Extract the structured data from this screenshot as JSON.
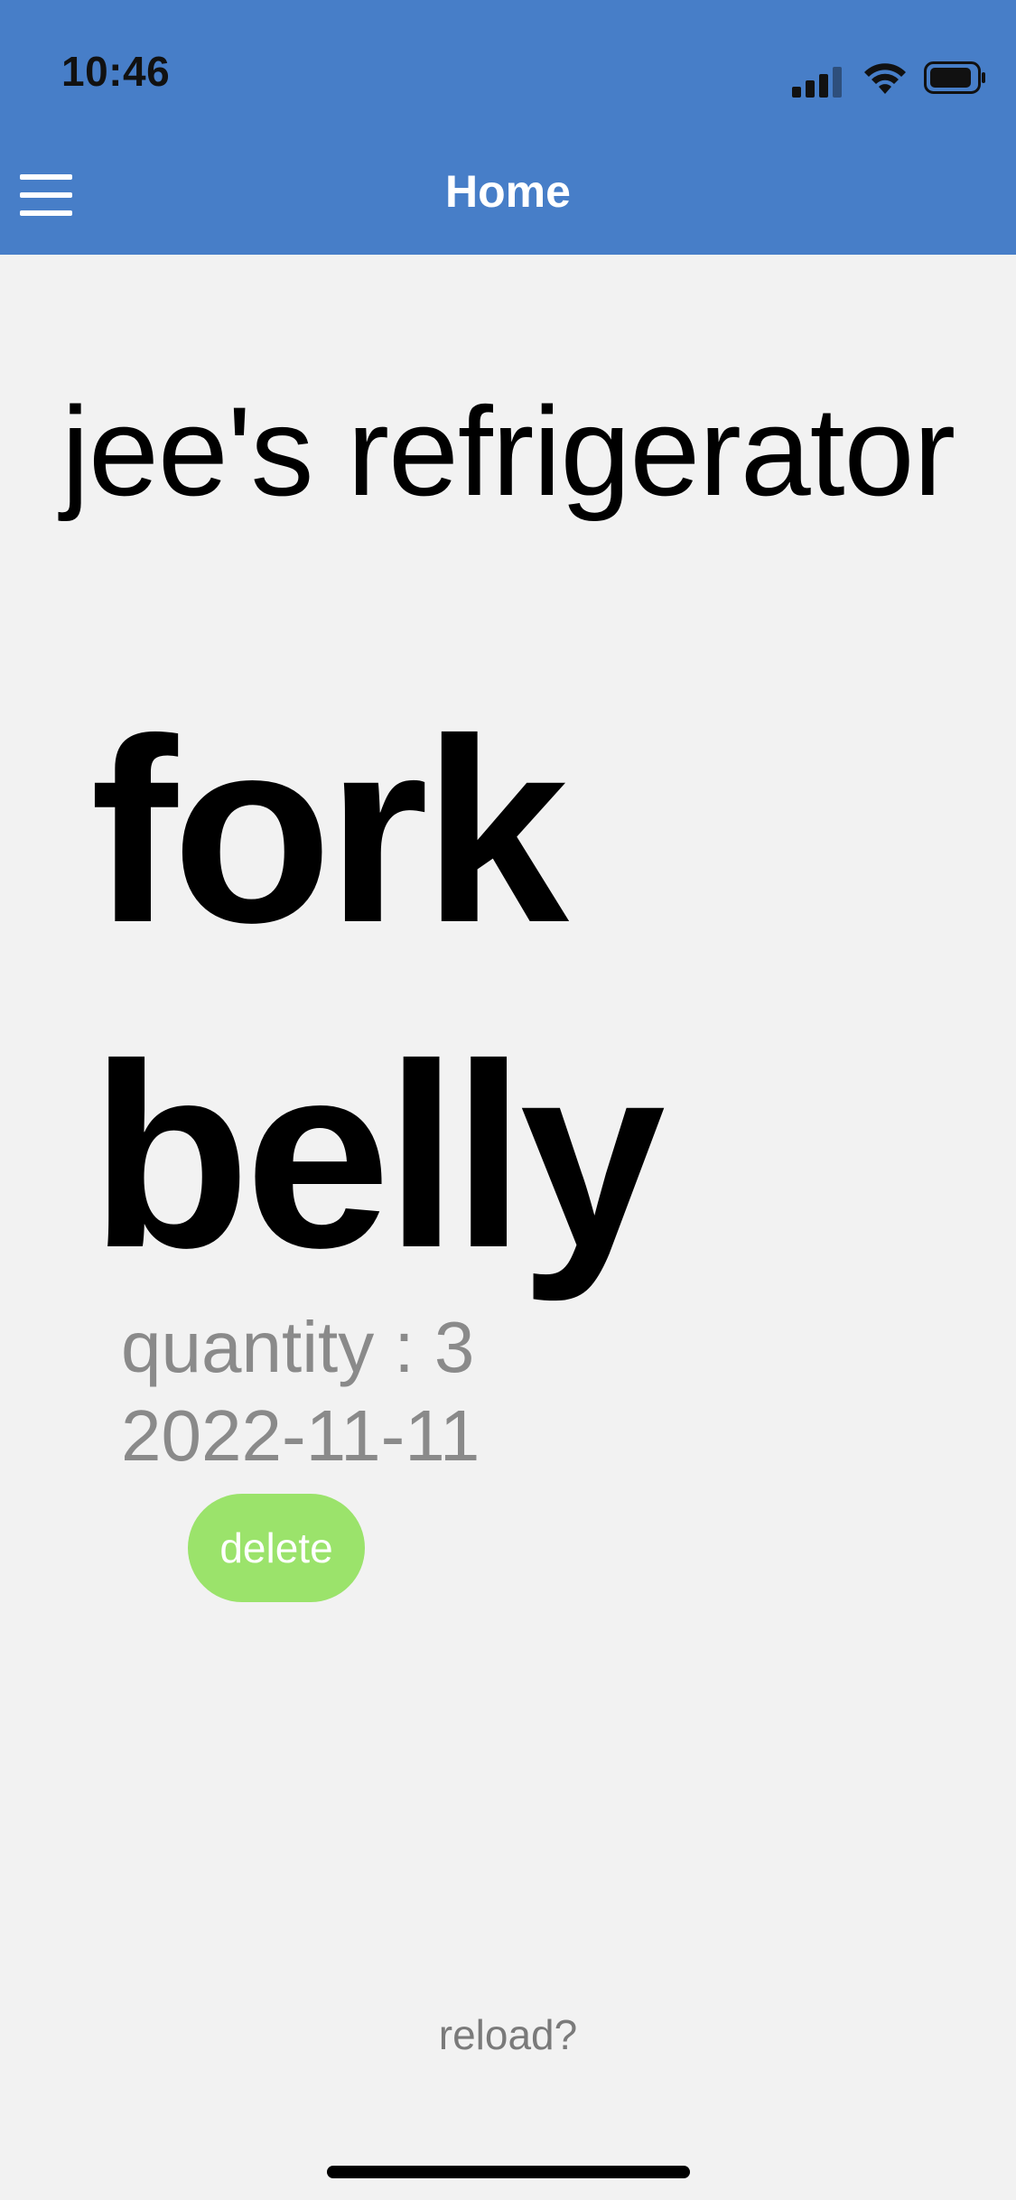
{
  "status_bar": {
    "time": "10:46",
    "icons": [
      "cellular-signal-icon",
      "wifi-icon",
      "battery-icon"
    ]
  },
  "header": {
    "title": "Home",
    "menu_icon": "hamburger-menu-icon",
    "background_color": "#477ec8"
  },
  "fridge": {
    "title": "jee's refrigerator"
  },
  "item": {
    "name": "fork belly",
    "quantity_text": "quantity : 3",
    "date": "2022-11-11",
    "delete_label": "delete",
    "delete_color": "#9be36b"
  },
  "footer": {
    "reload_label": "reload?"
  }
}
